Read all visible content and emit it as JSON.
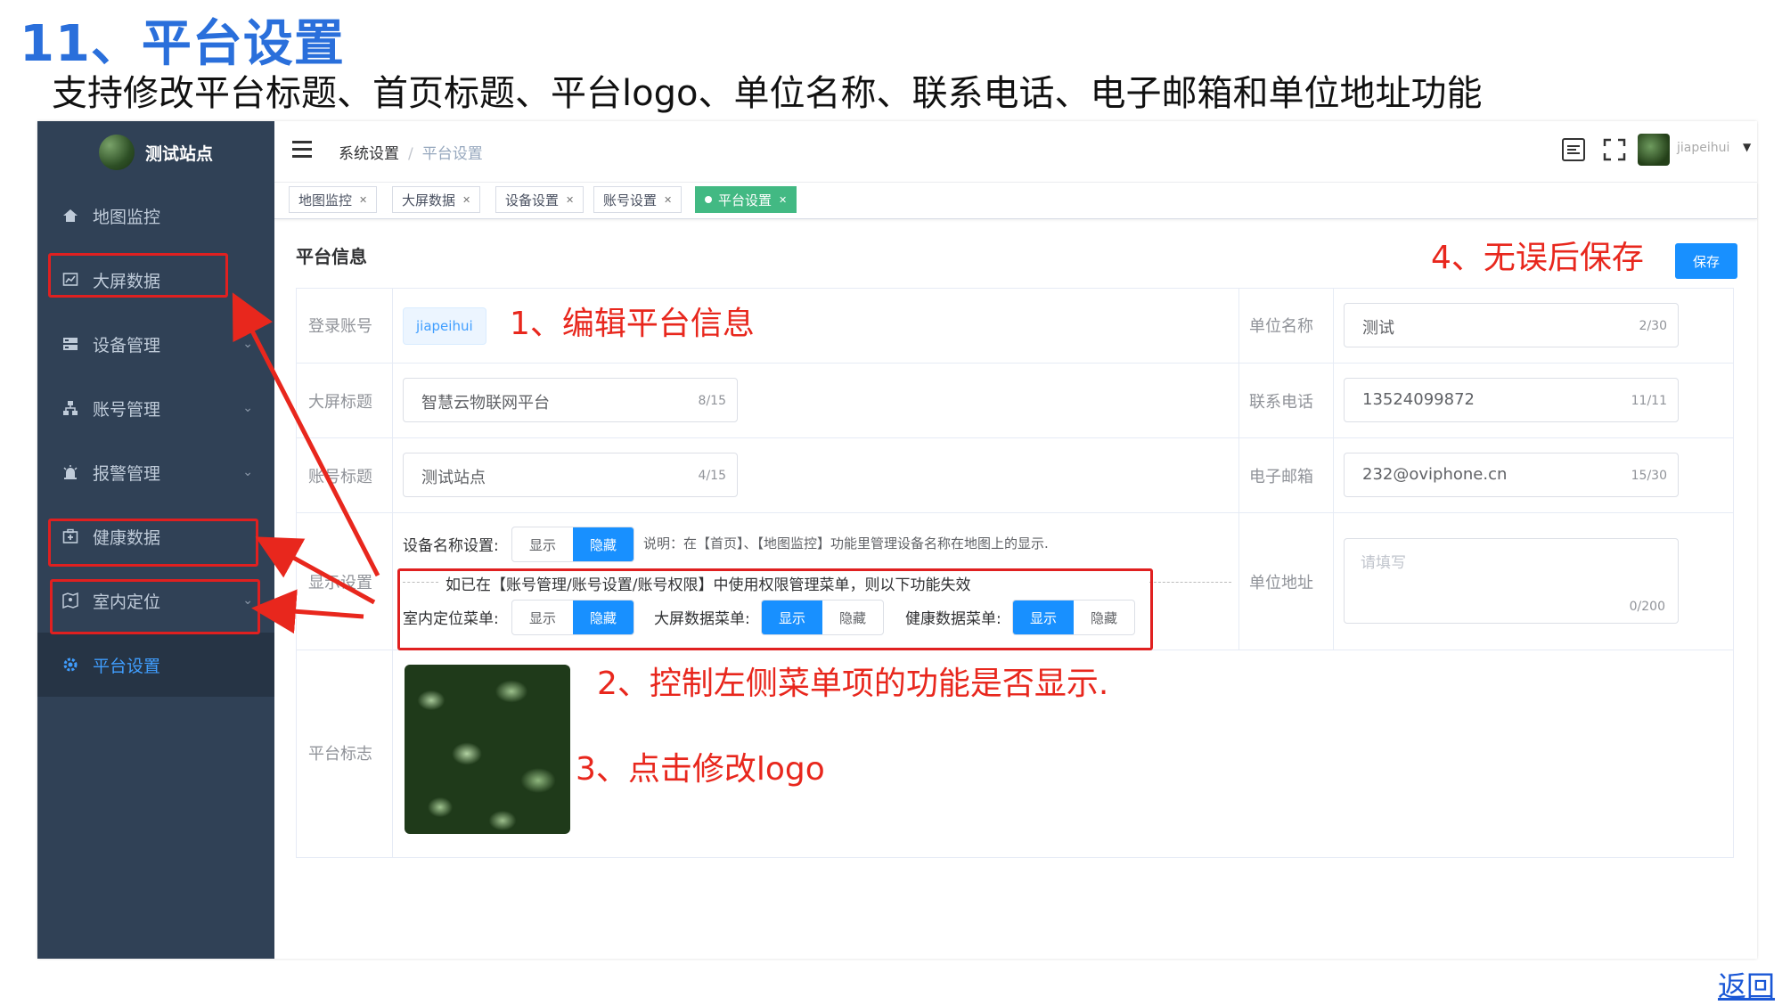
{
  "doc": {
    "title": "11、平台设置",
    "subtitle": "支持修改平台标题、首页标题、平台logo、单位名称、联系电话、电子邮箱和单位地址功能",
    "back_link": "返回"
  },
  "sidebar": {
    "brand": "测试站点",
    "items": [
      {
        "label": "地图监控",
        "icon": "home-icon"
      },
      {
        "label": "大屏数据",
        "icon": "chart-icon"
      },
      {
        "label": "设备管理",
        "icon": "server-icon"
      },
      {
        "label": "账号管理",
        "icon": "org-icon"
      },
      {
        "label": "报警管理",
        "icon": "alarm-icon"
      },
      {
        "label": "健康数据",
        "icon": "health-icon"
      },
      {
        "label": "室内定位",
        "icon": "location-icon"
      },
      {
        "label": "平台设置",
        "icon": "gear-icon"
      }
    ]
  },
  "header": {
    "breadcrumb": [
      "系统设置",
      "平台设置"
    ],
    "username": "jiapeihui"
  },
  "tags": [
    "地图监控",
    "大屏数据",
    "设备设置",
    "账号设置",
    "平台设置"
  ],
  "main": {
    "section_title": "平台信息",
    "save_label": "保存",
    "login_account_label": "登录账号",
    "login_account_value": "jiapeihui",
    "screen_title_label": "大屏标题",
    "screen_title_value": "智慧云物联网平台",
    "screen_title_count": "8/15",
    "account_title_label": "账号标题",
    "account_title_value": "测试站点",
    "account_title_count": "4/15",
    "display_settings_label": "显示设置",
    "device_name_label": "设备名称设置:",
    "device_name_note": "说明：在【首页】、【地图监控】功能里管理设备名称在地图上的显示.",
    "permission_note": "如已在【账号管理/账号设置/账号权限】中使用权限管理菜单，则以下功能失效",
    "indoor_menu_label": "室内定位菜单:",
    "screen_menu_label": "大屏数据菜单:",
    "health_menu_label": "健康数据菜单:",
    "show_label": "显示",
    "hide_label": "隐藏",
    "platform_logo_label": "平台标志",
    "unit_name_label": "单位名称",
    "unit_name_value": "测试",
    "unit_name_count": "2/30",
    "phone_label": "联系电话",
    "phone_value": "13524099872",
    "phone_count": "11/11",
    "email_label": "电子邮箱",
    "email_value": "232@oviphone.cn",
    "email_count": "15/30",
    "address_label": "单位地址",
    "address_placeholder": "请填写",
    "address_count": "0/200",
    "toggles": {
      "device_name": "隐藏",
      "indoor_menu": "隐藏",
      "screen_menu": "显示",
      "health_menu": "显示"
    }
  },
  "annotations": {
    "step1": "1、编辑平台信息",
    "step2": "2、控制左侧菜单项的功能是否显示.",
    "step3": "3、点击修改logo",
    "step4": "4、无误后保存"
  },
  "colors": {
    "sidebar_bg": "#304156",
    "accent": "#1890ff",
    "tag_active": "#42b983",
    "annotation_red": "#e8271d",
    "title_blue": "#2a6fdb"
  }
}
